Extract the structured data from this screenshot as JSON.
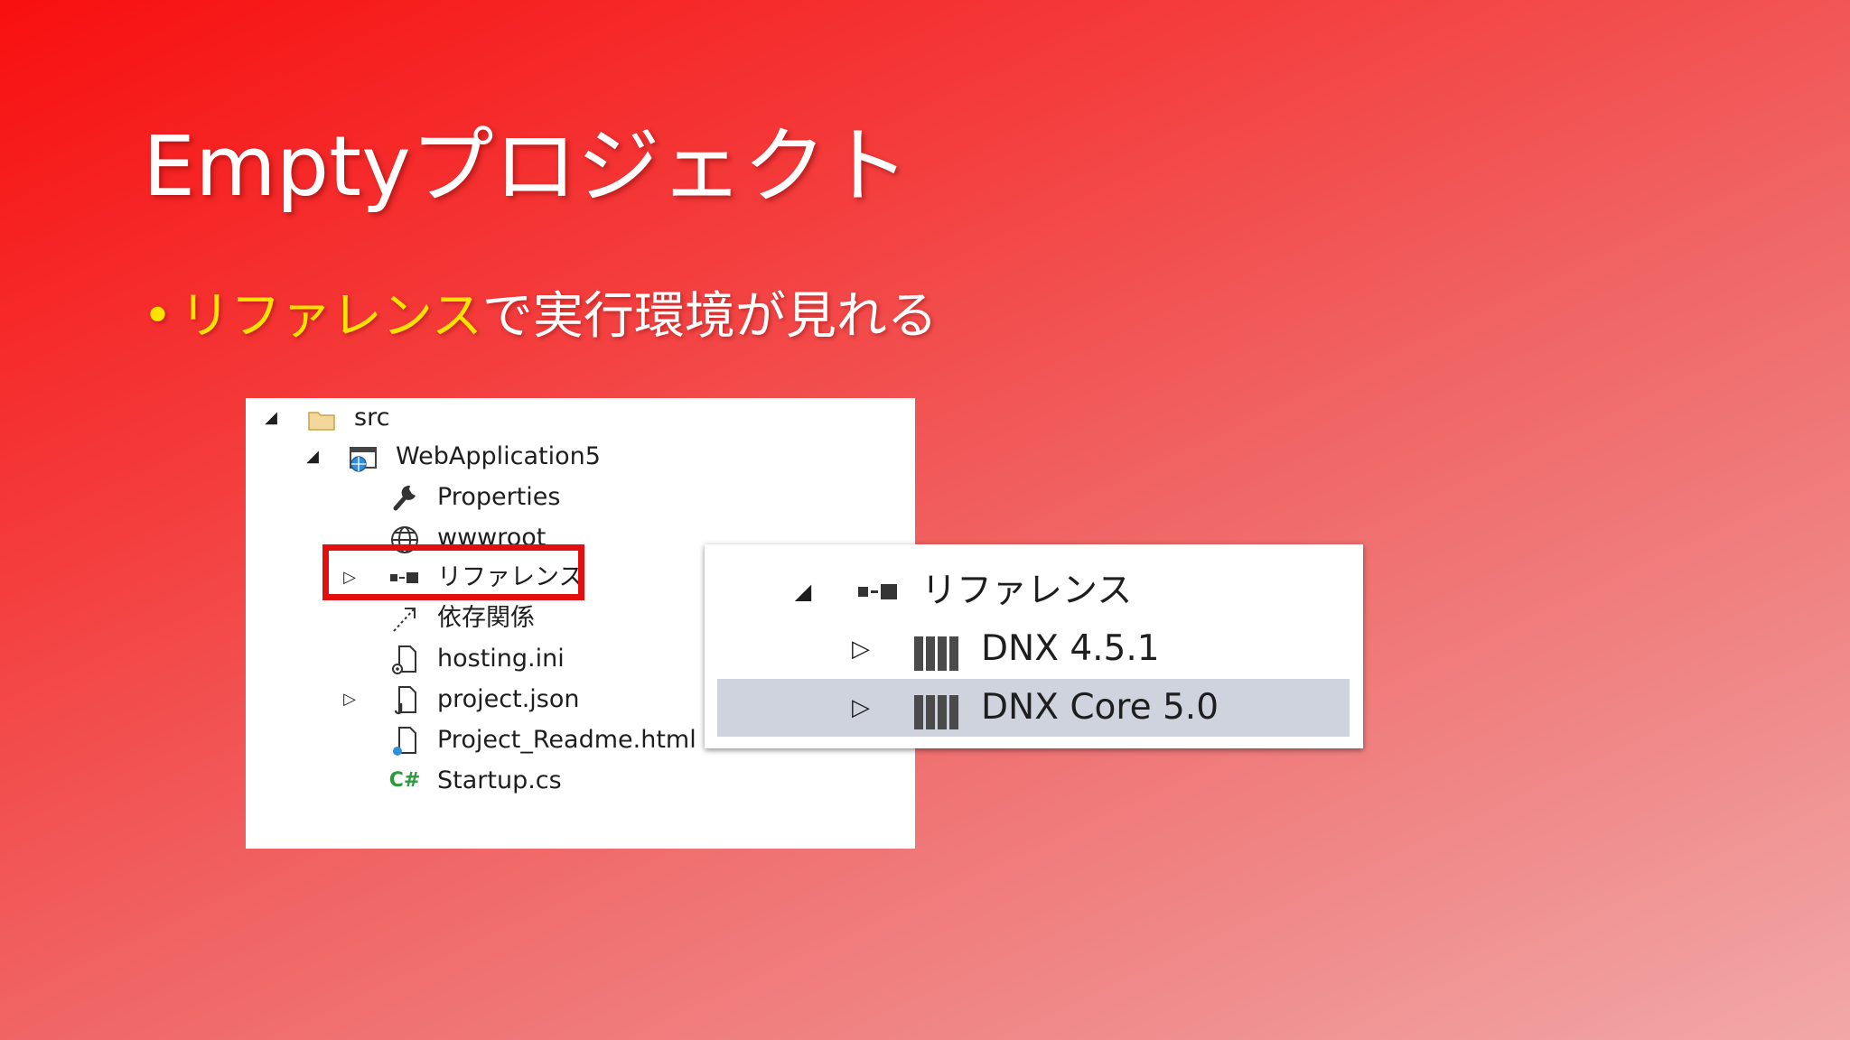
{
  "slide": {
    "title": "Emptyプロジェクト",
    "bullet": {
      "highlight": "リファレンス",
      "rest": "で実行環境が見れる"
    },
    "highlight_color": "#ffe300",
    "callout_color": "#e30e0e"
  },
  "explorer": {
    "src": "src",
    "project": "WebApplication5",
    "properties": "Properties",
    "wwwroot": "wwwroot",
    "references": "リファレンス",
    "dependencies": "依存関係",
    "hosting": "hosting.ini",
    "project_json": "project.json",
    "readme": "Project_Readme.html",
    "startup": "Startup.cs"
  },
  "references_panel": {
    "title": "リファレンス",
    "items": [
      "DNX 4.5.1",
      "DNX Core 5.0"
    ],
    "selected_item": "DNX Core 5.0"
  }
}
